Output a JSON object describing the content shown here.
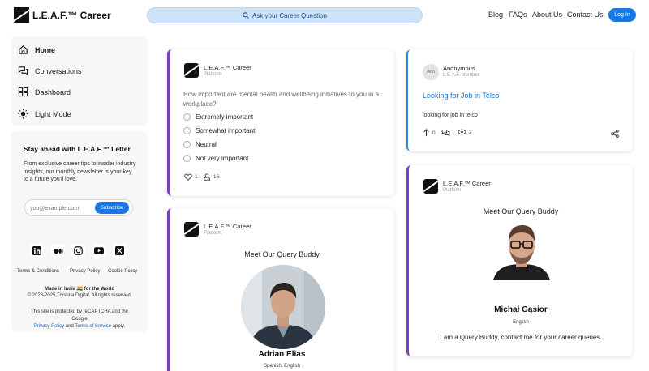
{
  "header": {
    "logo_text": "L.E.A.F.™ Career",
    "ask_label": "Ask your Career Question",
    "nav": [
      "Blog",
      "FAQs",
      "About Us",
      "Contact Us"
    ],
    "login_label": "Log In"
  },
  "sidebar": {
    "items": [
      {
        "label": "Home",
        "icon": "home-icon"
      },
      {
        "label": "Conversations",
        "icon": "chat-icon"
      },
      {
        "label": "Dashboard",
        "icon": "dashboard-icon"
      },
      {
        "label": "Light Mode",
        "icon": "sun-icon"
      }
    ],
    "newsletter": {
      "title": "Stay ahead with L.E.A.F.™ Letter",
      "description": "From exclusive career tips to insider industry insights, our monthly newsletter is your key to a future you'll love.",
      "email_placeholder": "you@example.com",
      "subscribe_label": "Subscribe"
    },
    "socials": [
      "linkedin-icon",
      "medium-icon",
      "instagram-icon",
      "youtube-icon",
      "x-icon"
    ],
    "footer_links": [
      "Terms & Conditions",
      "Privacy Policy",
      "Cookie Policy"
    ],
    "made_in": "Made in India 🇮🇳 for the World",
    "copyright": "© 2023-2025 Tryshna Digital. All rights reserved.",
    "recaptcha_1": "This site is protected by reCAPTCHA and the",
    "recaptcha_2": "Google",
    "privacy_label": "Privacy Policy",
    "and_label": "and",
    "tos_label": "Terms of Service",
    "apply_label": "apply."
  },
  "feed": {
    "poll_card": {
      "author": "L.E.A.F.™ Career",
      "role": "Platform",
      "question": "How important are mental health and wellbeing initiatives to you in a workplace?",
      "options": [
        "Extremely important",
        "Somewhat important",
        "Neutral",
        "Not very important"
      ],
      "likes": "1",
      "voters": "16"
    },
    "anon_card": {
      "avatar_text": "Ano",
      "author": "Anonymous",
      "role": "L.E.A.F. Member",
      "title": "Looking for Job in Telco",
      "body": "looking for job in telco",
      "upvotes": "0",
      "views": "2"
    },
    "buddy_card_left": {
      "author": "L.E.A.F.™ Career",
      "role": "Platform",
      "heading": "Meet Our Query Buddy",
      "name": "Adrian Elias",
      "languages": "Spanish, English"
    },
    "buddy_card_right": {
      "author": "L.E.A.F.™ Career",
      "role": "Platform",
      "heading": "Meet Our Query Buddy",
      "name": "Michał Gąsior",
      "languages": "English",
      "message": "I am a Query Buddy, contact me for your career queries."
    }
  },
  "colors": {
    "accent": "#1877e5",
    "purple_accent": "#7b3fbf",
    "blue_accent": "#2e86de"
  }
}
